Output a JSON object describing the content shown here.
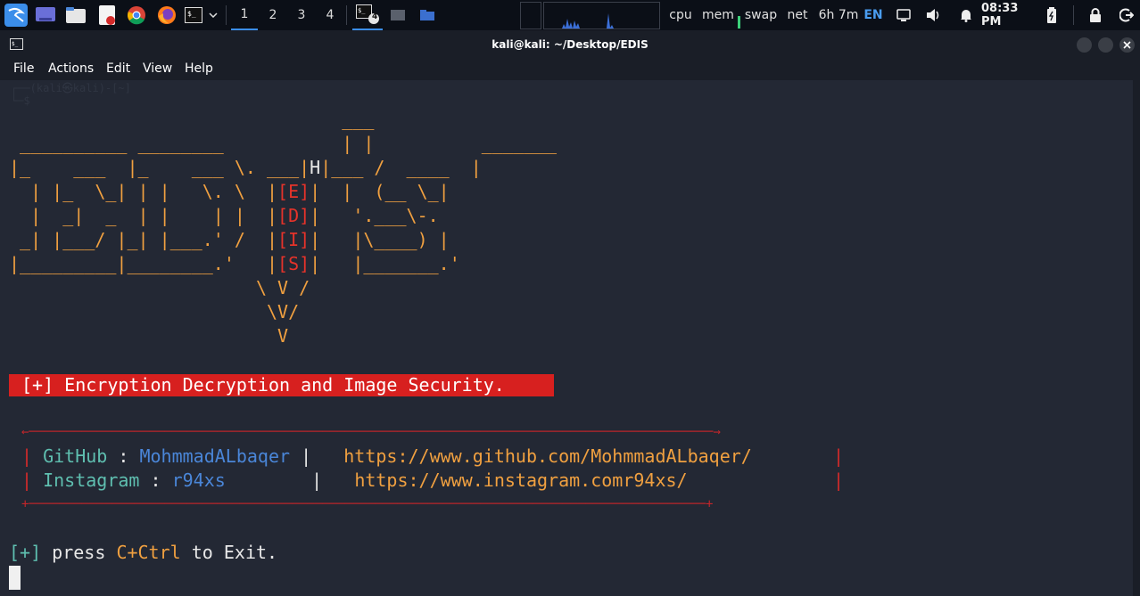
{
  "panel": {
    "workspaces": [
      "1",
      "2",
      "3",
      "4"
    ],
    "active_workspace": "1",
    "terminal_badge": "4",
    "monitors": [
      "cpu",
      "mem",
      "swap",
      "net"
    ],
    "uptime": "6h 7m",
    "language": "EN",
    "time": "08:33 PM",
    "icons": [
      "kali-menu-icon",
      "desktop-icon",
      "file-manager-icon",
      "text-editor-icon",
      "chrome-icon",
      "firefox-icon",
      "terminal-icon",
      "display-icon",
      "volume-icon",
      "bell-icon",
      "battery-icon",
      "lock-icon",
      "logout-icon"
    ]
  },
  "window": {
    "title": "kali@kali: ~/Desktop/EDIS",
    "menu": [
      "File",
      "Actions",
      "Edit",
      "View",
      "Help"
    ]
  },
  "terminal": {
    "ghost_prompt": "┌──(kali㉿kali)-[~]\n└─$ ",
    "banner_text": "[+] Encryption Decryption and Image Security.",
    "github_label": "GitHub",
    "github_user": "MohmmadALbaqer",
    "github_url": "https://www.github.com/MohmmadALbaqer/",
    "instagram_label": "Instagram",
    "instagram_user": "r94xs",
    "instagram_url": "https://www.instagram.comr94xs/",
    "exit_prefix": "[+]",
    "exit_press": "press",
    "exit_keys": "C+Ctrl",
    "exit_rest": "to Exit."
  },
  "colors": {
    "background": "#232834",
    "art_orange": "#f0a040",
    "art_red": "#e5332a",
    "banner_bg": "#d7201f",
    "teal": "#5fbfb0",
    "blue": "#4a86d8"
  }
}
